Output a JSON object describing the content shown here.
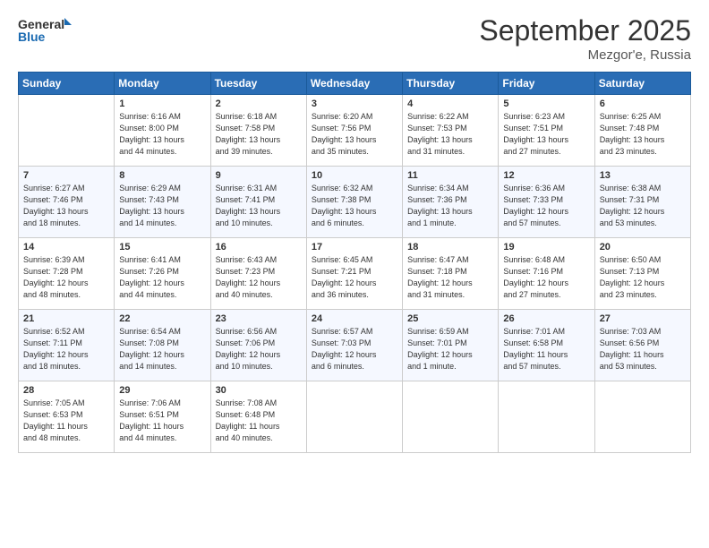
{
  "logo": {
    "line1": "General",
    "line2": "Blue"
  },
  "title": "September 2025",
  "location": "Mezgor'e, Russia",
  "days_header": [
    "Sunday",
    "Monday",
    "Tuesday",
    "Wednesday",
    "Thursday",
    "Friday",
    "Saturday"
  ],
  "weeks": [
    [
      {
        "day": "",
        "info": ""
      },
      {
        "day": "1",
        "info": "Sunrise: 6:16 AM\nSunset: 8:00 PM\nDaylight: 13 hours\nand 44 minutes."
      },
      {
        "day": "2",
        "info": "Sunrise: 6:18 AM\nSunset: 7:58 PM\nDaylight: 13 hours\nand 39 minutes."
      },
      {
        "day": "3",
        "info": "Sunrise: 6:20 AM\nSunset: 7:56 PM\nDaylight: 13 hours\nand 35 minutes."
      },
      {
        "day": "4",
        "info": "Sunrise: 6:22 AM\nSunset: 7:53 PM\nDaylight: 13 hours\nand 31 minutes."
      },
      {
        "day": "5",
        "info": "Sunrise: 6:23 AM\nSunset: 7:51 PM\nDaylight: 13 hours\nand 27 minutes."
      },
      {
        "day": "6",
        "info": "Sunrise: 6:25 AM\nSunset: 7:48 PM\nDaylight: 13 hours\nand 23 minutes."
      }
    ],
    [
      {
        "day": "7",
        "info": "Sunrise: 6:27 AM\nSunset: 7:46 PM\nDaylight: 13 hours\nand 18 minutes."
      },
      {
        "day": "8",
        "info": "Sunrise: 6:29 AM\nSunset: 7:43 PM\nDaylight: 13 hours\nand 14 minutes."
      },
      {
        "day": "9",
        "info": "Sunrise: 6:31 AM\nSunset: 7:41 PM\nDaylight: 13 hours\nand 10 minutes."
      },
      {
        "day": "10",
        "info": "Sunrise: 6:32 AM\nSunset: 7:38 PM\nDaylight: 13 hours\nand 6 minutes."
      },
      {
        "day": "11",
        "info": "Sunrise: 6:34 AM\nSunset: 7:36 PM\nDaylight: 13 hours\nand 1 minute."
      },
      {
        "day": "12",
        "info": "Sunrise: 6:36 AM\nSunset: 7:33 PM\nDaylight: 12 hours\nand 57 minutes."
      },
      {
        "day": "13",
        "info": "Sunrise: 6:38 AM\nSunset: 7:31 PM\nDaylight: 12 hours\nand 53 minutes."
      }
    ],
    [
      {
        "day": "14",
        "info": "Sunrise: 6:39 AM\nSunset: 7:28 PM\nDaylight: 12 hours\nand 48 minutes."
      },
      {
        "day": "15",
        "info": "Sunrise: 6:41 AM\nSunset: 7:26 PM\nDaylight: 12 hours\nand 44 minutes."
      },
      {
        "day": "16",
        "info": "Sunrise: 6:43 AM\nSunset: 7:23 PM\nDaylight: 12 hours\nand 40 minutes."
      },
      {
        "day": "17",
        "info": "Sunrise: 6:45 AM\nSunset: 7:21 PM\nDaylight: 12 hours\nand 36 minutes."
      },
      {
        "day": "18",
        "info": "Sunrise: 6:47 AM\nSunset: 7:18 PM\nDaylight: 12 hours\nand 31 minutes."
      },
      {
        "day": "19",
        "info": "Sunrise: 6:48 AM\nSunset: 7:16 PM\nDaylight: 12 hours\nand 27 minutes."
      },
      {
        "day": "20",
        "info": "Sunrise: 6:50 AM\nSunset: 7:13 PM\nDaylight: 12 hours\nand 23 minutes."
      }
    ],
    [
      {
        "day": "21",
        "info": "Sunrise: 6:52 AM\nSunset: 7:11 PM\nDaylight: 12 hours\nand 18 minutes."
      },
      {
        "day": "22",
        "info": "Sunrise: 6:54 AM\nSunset: 7:08 PM\nDaylight: 12 hours\nand 14 minutes."
      },
      {
        "day": "23",
        "info": "Sunrise: 6:56 AM\nSunset: 7:06 PM\nDaylight: 12 hours\nand 10 minutes."
      },
      {
        "day": "24",
        "info": "Sunrise: 6:57 AM\nSunset: 7:03 PM\nDaylight: 12 hours\nand 6 minutes."
      },
      {
        "day": "25",
        "info": "Sunrise: 6:59 AM\nSunset: 7:01 PM\nDaylight: 12 hours\nand 1 minute."
      },
      {
        "day": "26",
        "info": "Sunrise: 7:01 AM\nSunset: 6:58 PM\nDaylight: 11 hours\nand 57 minutes."
      },
      {
        "day": "27",
        "info": "Sunrise: 7:03 AM\nSunset: 6:56 PM\nDaylight: 11 hours\nand 53 minutes."
      }
    ],
    [
      {
        "day": "28",
        "info": "Sunrise: 7:05 AM\nSunset: 6:53 PM\nDaylight: 11 hours\nand 48 minutes."
      },
      {
        "day": "29",
        "info": "Sunrise: 7:06 AM\nSunset: 6:51 PM\nDaylight: 11 hours\nand 44 minutes."
      },
      {
        "day": "30",
        "info": "Sunrise: 7:08 AM\nSunset: 6:48 PM\nDaylight: 11 hours\nand 40 minutes."
      },
      {
        "day": "",
        "info": ""
      },
      {
        "day": "",
        "info": ""
      },
      {
        "day": "",
        "info": ""
      },
      {
        "day": "",
        "info": ""
      }
    ]
  ]
}
